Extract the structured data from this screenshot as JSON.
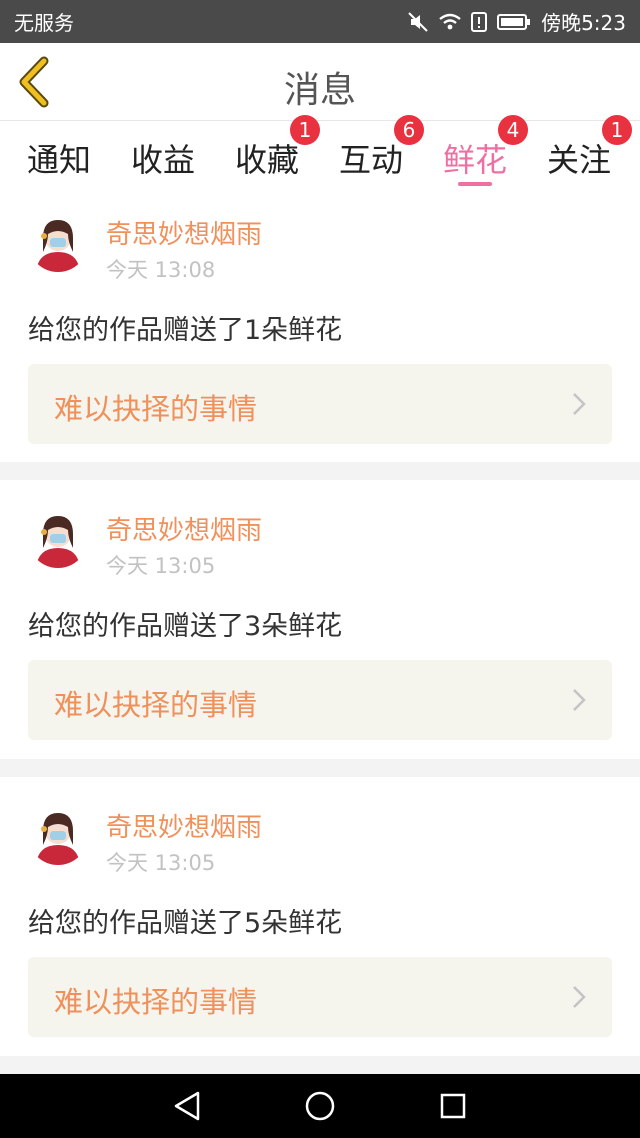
{
  "status_bar": {
    "carrier": "无服务",
    "time": "傍晚5:23"
  },
  "header": {
    "title": "消息"
  },
  "tabs": [
    {
      "label": "通知",
      "badge": ""
    },
    {
      "label": "收益",
      "badge": ""
    },
    {
      "label": "收藏",
      "badge": "1"
    },
    {
      "label": "互动",
      "badge": "6"
    },
    {
      "label": "鲜花",
      "badge": "4",
      "active": true
    },
    {
      "label": "关注",
      "badge": "1"
    }
  ],
  "messages": [
    {
      "user": "奇思妙想烟雨",
      "time": "今天 13:08",
      "text": "给您的作品赠送了1朵鲜花",
      "work": "难以抉择的事情"
    },
    {
      "user": "奇思妙想烟雨",
      "time": "今天 13:05",
      "text": "给您的作品赠送了3朵鲜花",
      "work": "难以抉择的事情"
    },
    {
      "user": "奇思妙想烟雨",
      "time": "今天 13:05",
      "text": "给您的作品赠送了5朵鲜花",
      "work": "难以抉择的事情"
    }
  ],
  "colors": {
    "accent": "#ef6fa3",
    "name": "#f0905a",
    "badge": "#e8323f",
    "back": "#f0c020"
  },
  "icons": [
    "back-arrow-icon",
    "mute-icon",
    "wifi-icon",
    "alert-icon",
    "battery-icon",
    "chevron-right-icon",
    "nav-back-icon",
    "nav-home-icon",
    "nav-recent-icon",
    "avatar"
  ]
}
